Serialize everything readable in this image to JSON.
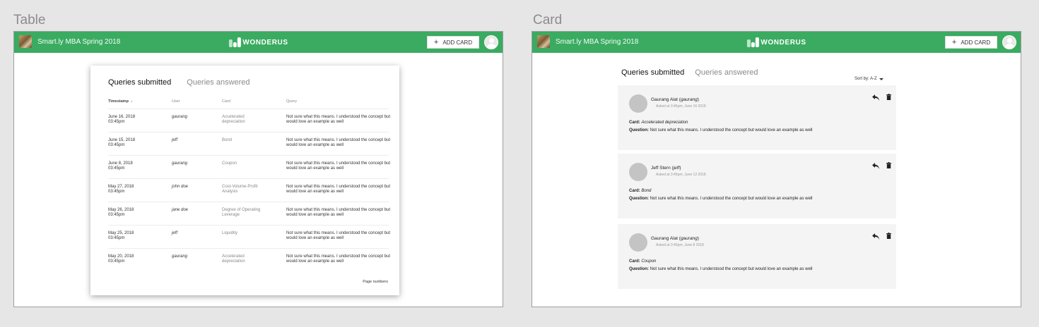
{
  "labels": {
    "table": "Table",
    "card": "Card"
  },
  "appbar": {
    "course_title": "Smart.ly MBA Spring 2018",
    "logo_text": "WONDERUS",
    "add_card_plus": "+",
    "add_card_label": "ADD CARD",
    "brand_color": "#3aab61"
  },
  "tabs": {
    "submitted": "Queries submitted",
    "answered": "Queries answered"
  },
  "table": {
    "headers": {
      "timestamp": "Timestamp",
      "sort_arrow": "↓",
      "user": "User",
      "card": "Card",
      "query": "Query"
    },
    "rows": [
      {
        "timestamp": "June 16, 2018\n03:45pm",
        "user": "gaurang",
        "card": "Accelerated\ndepreciation",
        "query": "Not sure what this means. I understood the concept but would love an example as well"
      },
      {
        "timestamp": "June 15, 2018\n03:45pm",
        "user": "jeff",
        "card": "Bond",
        "query": "Not sure what this means. I understood the concept but would love an example as well"
      },
      {
        "timestamp": "June 8, 2018\n03:45pm",
        "user": "gaurang",
        "card": "Coupon",
        "query": "Not sure what this means. I understood the concept but would love an example as well"
      },
      {
        "timestamp": "May 27, 2018\n03:45pm",
        "user": "john doe",
        "card": "Cost-Volume-Profit\nAnalysis",
        "query": "Not sure what this means. I understood the concept but would love an example as well"
      },
      {
        "timestamp": "May 26, 2018\n03:45pm",
        "user": "jane doe",
        "card": "Degree of Operating\nLeverage",
        "query": "Not sure what this means. I understood the concept but would love an example as well"
      },
      {
        "timestamp": "May 25, 2018\n03:45pm",
        "user": "jeff",
        "card": "Liquidity",
        "query": "Not sure what this means. I understood the concept but would love an example as well"
      },
      {
        "timestamp": "May 20, 2018\n03:45pm",
        "user": "gaurang",
        "card": "Accelerated\ndepreciation",
        "query": "Not sure what this means. I understood the concept but would love an example as well"
      }
    ],
    "page_numbers": "Page numbers"
  },
  "cards": {
    "sort_label": "Sort by: A-Z",
    "card_key": "Card:",
    "question_key": "Question:",
    "items": [
      {
        "name": "Gaurang Alat",
        "username": "gaurang",
        "asked": "Asked at 3:45pm, June 16 2018",
        "card": "Accelerated depreciation",
        "question": "Not sure what this means. I understood the concept but would love an example as well"
      },
      {
        "name": "Jeff Stern",
        "username": "jeff",
        "asked": "Asked at 3:45pm, June 12 2018",
        "card": "Bond",
        "question": "Not sure what this means. I understood the concept but would love an example as well"
      },
      {
        "name": "Gaurang Alat",
        "username": "gaurang",
        "asked": "Asked at 3:45pm, June 8 2018",
        "card": "Coupon",
        "question": "Not sure what this means. I understood the concept but would love an example as well"
      }
    ]
  }
}
